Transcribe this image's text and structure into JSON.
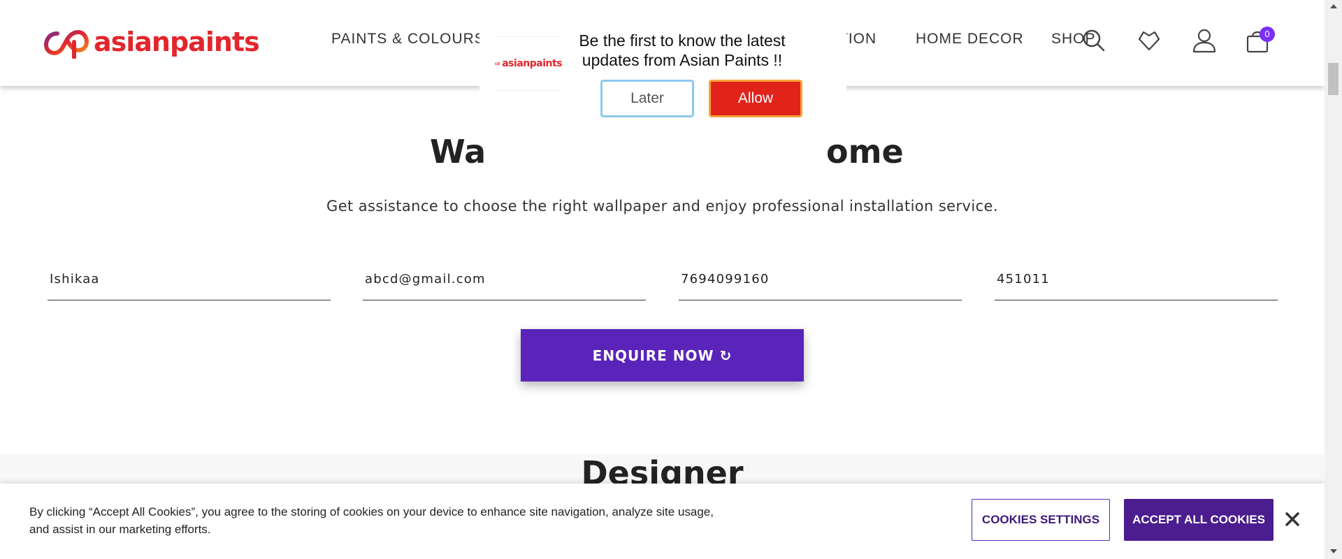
{
  "brand": {
    "name": "asianpaints"
  },
  "nav": {
    "items": [
      {
        "label": "PAINTS & COLOURS"
      },
      {
        "label": "TION"
      },
      {
        "label": "HOME DECOR"
      },
      {
        "label": "SHOP"
      }
    ]
  },
  "header_icons": {
    "search": "search-icon",
    "wishlist": "heart-icon",
    "account": "user-icon",
    "cart": "cart-icon",
    "cart_count": "0"
  },
  "push_prompt": {
    "logo_text": "asianpaints",
    "message": "Be the first to know the latest updates from Asian Paints !!",
    "later_label": "Later",
    "allow_label": "Allow"
  },
  "main": {
    "heading_left": "Wa",
    "heading_right": "ome",
    "subtitle": "Get assistance to choose the right wallpaper and enjoy professional installation service.",
    "fields": [
      {
        "value": "Ishikaa"
      },
      {
        "value": "abcd@gmail.com"
      },
      {
        "value": "7694099160"
      },
      {
        "value": "451011"
      }
    ],
    "enquire_label": "ENQUIRE NOW",
    "enquire_icon": "↻",
    "next_heading": "Designer"
  },
  "cookie": {
    "text": "By clicking “Accept All Cookies”, you agree to the storing of cookies on your device to enhance site navigation, analyze site usage, and assist in our marketing efforts.",
    "settings_label": "COOKIES SETTINGS",
    "accept_label": "ACCEPT ALL COOKIES"
  },
  "colors": {
    "brand_red": "#e2262d",
    "brand_purple": "#5a23b9",
    "accept_purple": "#4b1d8f",
    "allow_red": "#e2231a"
  }
}
